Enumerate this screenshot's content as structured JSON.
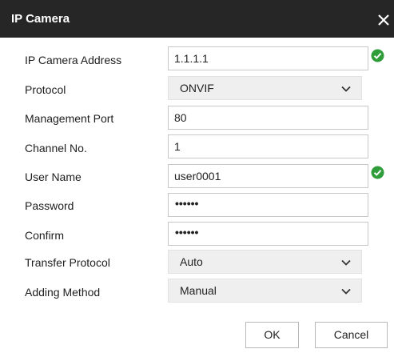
{
  "dialog": {
    "title": "IP Camera"
  },
  "form": {
    "ip_address": {
      "label": "IP Camera Address",
      "value": "1.1.1.1"
    },
    "protocol": {
      "label": "Protocol",
      "value": "ONVIF"
    },
    "management_port": {
      "label": "Management Port",
      "value": "80"
    },
    "channel_no": {
      "label": "Channel No.",
      "value": "1"
    },
    "user_name": {
      "label": "User Name",
      "value": "user0001"
    },
    "password": {
      "label": "Password",
      "value": "••••••"
    },
    "confirm": {
      "label": "Confirm",
      "value": "••••••"
    },
    "transfer_protocol": {
      "label": "Transfer Protocol",
      "value": "Auto"
    },
    "adding_method": {
      "label": "Adding Method",
      "value": "Manual"
    }
  },
  "buttons": {
    "ok": "OK",
    "cancel": "Cancel"
  },
  "colors": {
    "title_bar": "#262626",
    "valid_check": "#2e9d3a",
    "select_bg": "#efefef"
  },
  "icons": {
    "close": "close-icon",
    "valid": "check-circle-icon",
    "dropdown": "chevron-down-icon"
  }
}
